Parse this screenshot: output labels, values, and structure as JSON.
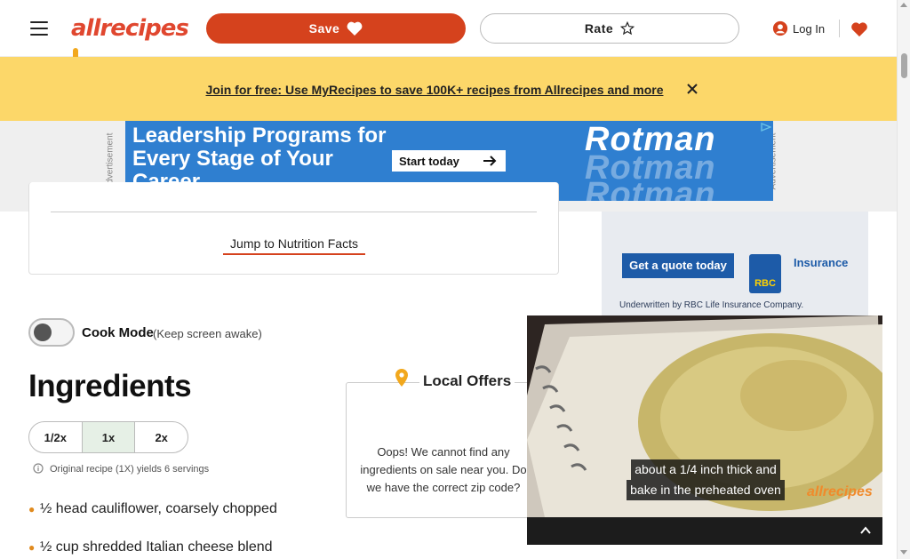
{
  "header": {
    "logo_text": "allrecipes",
    "save_label": "Save",
    "rate_label": "Rate",
    "login_label": "Log In"
  },
  "banner": {
    "link_text": "Join for free: Use MyRecipes to save 100K+ recipes from Allrecipes and more",
    "color": "#fcd769"
  },
  "top_ad": {
    "label": "Advertisement",
    "headline": [
      "Leadership Programs for",
      "Every Stage of Your",
      "Career"
    ],
    "cta": "Start today",
    "brand": "Rotman",
    "color": "#2f7fd0"
  },
  "recipe_card": {
    "jump_link": "Jump to Nutrition Facts"
  },
  "side_ad": {
    "cta": "Get a quote today",
    "logo_text": "RBC",
    "product": "Insurance",
    "fine_print": "Underwritten by RBC Life Insurance Company."
  },
  "cook_mode": {
    "label": "Cook Mode",
    "sub": "(Keep screen awake)",
    "enabled": false
  },
  "ingredients": {
    "title": "Ingredients",
    "scale_options": [
      "1/2x",
      "1x",
      "2x"
    ],
    "selected_scale": "1x",
    "yield_text": "Original recipe (1X) yields 6 servings",
    "items": [
      "½ head cauliflower, coarsely chopped",
      "½ cup shredded Italian cheese blend"
    ]
  },
  "local_offers": {
    "title": "Local Offers",
    "message": "Oops! We cannot find any ingredients on sale near you. Do we have the correct zip code?"
  },
  "video": {
    "caption_line1": "about a 1/4 inch thick and",
    "caption_line2": "bake in the preheated oven",
    "watermark": "allrecipes"
  },
  "colors": {
    "brand_red": "#d5421d",
    "bullet_orange": "#e08a1e"
  }
}
